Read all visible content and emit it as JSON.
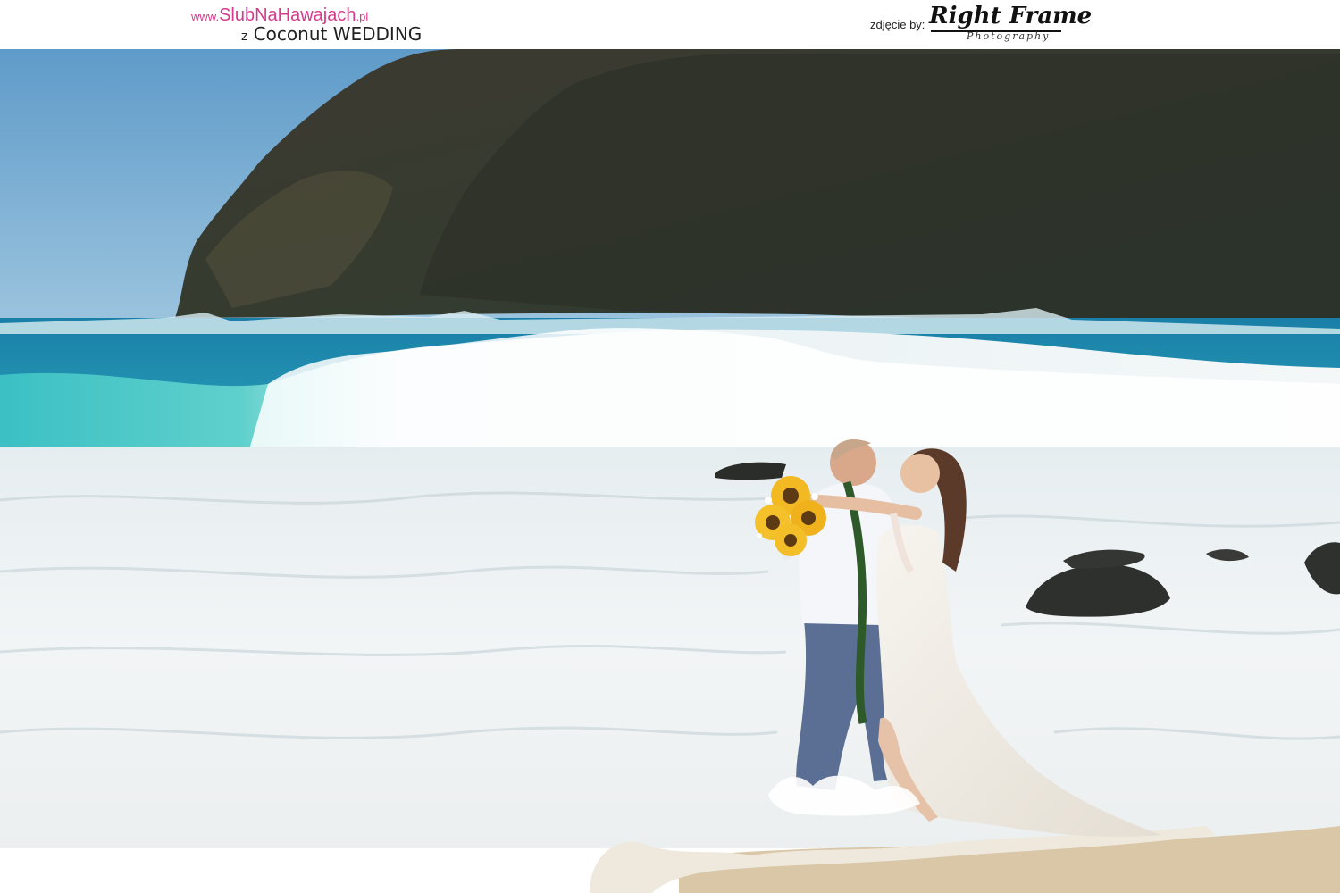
{
  "header": {
    "site_url_prefix": "www.",
    "site_url_name": "SlubNaHawajach",
    "site_url_suffix": ".pl",
    "tagline_prefix": "z",
    "tagline_brand": "Coconut WEDDING",
    "credit_prefix": "zdjęcie by:",
    "credit_brand": "Right Frame",
    "credit_brand_sub": "Photography"
  },
  "colors": {
    "site_url": "#d63a8b",
    "sky": "#6fa6cf",
    "ocean": "#1a8fb0",
    "foam": "#eef3f5",
    "cliff": "#3a3d33",
    "sand": "#d8c4a4"
  },
  "icons": [
    "logo-right-frame"
  ]
}
